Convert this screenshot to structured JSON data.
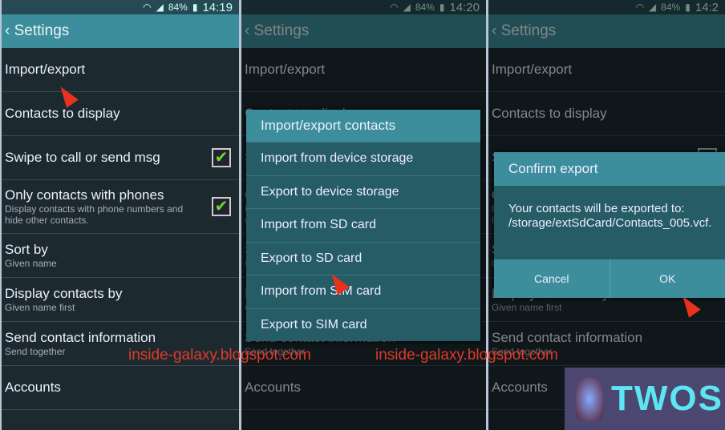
{
  "panels": [
    {
      "time": "14:19",
      "battery": "84%"
    },
    {
      "time": "14:20",
      "battery": "84%"
    },
    {
      "time": "14:2",
      "battery": "84%"
    }
  ],
  "header": {
    "title": "Settings"
  },
  "rows": [
    {
      "label": "Import/export"
    },
    {
      "label": "Contacts to display"
    },
    {
      "label": "Swipe to call or send msg"
    },
    {
      "label": "Only contacts with phones",
      "sub": "Display contacts with phone numbers and hide other contacts."
    },
    {
      "label": "Sort by",
      "sub": "Given name"
    },
    {
      "label": "Display contacts by",
      "sub": "Given name first"
    },
    {
      "label": "Send contact information",
      "sub": "Send together"
    },
    {
      "label": "Accounts"
    }
  ],
  "dialog1": {
    "title": "Import/export contacts",
    "items": [
      "Import from device storage",
      "Export to device storage",
      "Import from SD card",
      "Export to SD card",
      "Import from SIM card",
      "Export to SIM card"
    ]
  },
  "dialog2": {
    "title": "Confirm export",
    "message": "Your contacts will be exported to: /storage/extSdCard/Contacts_005.vcf.",
    "cancel": "Cancel",
    "ok": "OK"
  },
  "watermark": "inside-galaxy.blogspot.com",
  "logo": "TWOS"
}
